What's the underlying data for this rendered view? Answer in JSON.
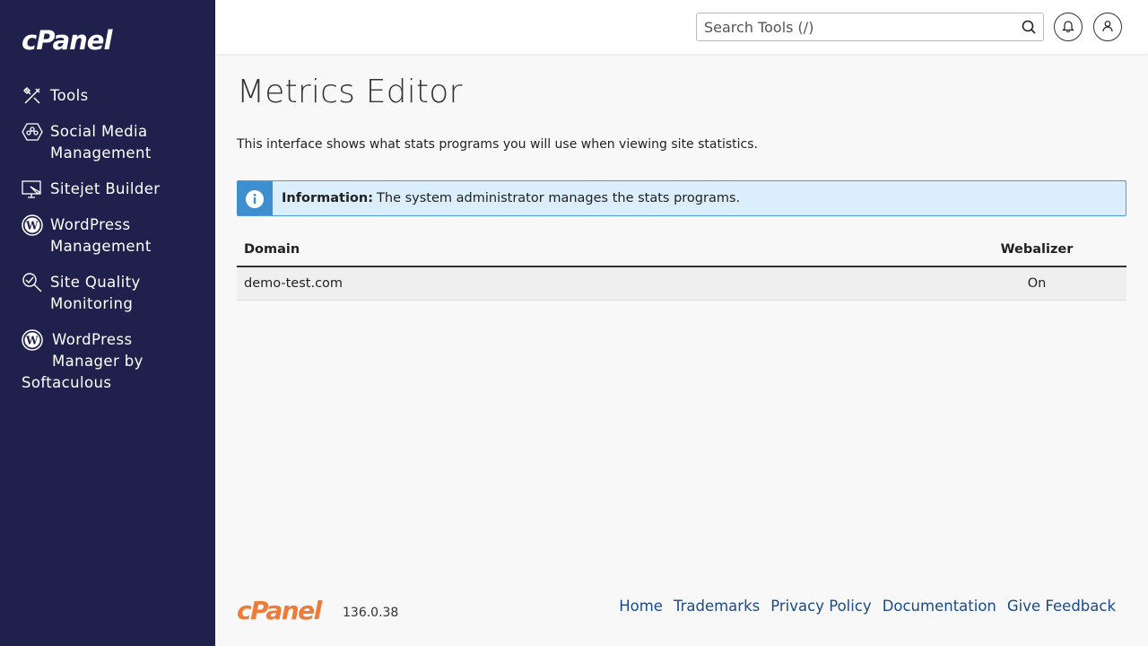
{
  "brand": {
    "logo_text": "cPanel",
    "footer_logo_text": "cPanel",
    "version": "136.0.38"
  },
  "sidebar": {
    "items": [
      {
        "label": "Tools",
        "icon": "tools-icon"
      },
      {
        "label": "Social Media\nManagement",
        "icon": "social-media-icon"
      },
      {
        "label": "Sitejet Builder",
        "icon": "sitejet-icon"
      },
      {
        "label": "WordPress\nManagement",
        "icon": "wordpress-icon"
      },
      {
        "label": "Site Quality\nMonitoring",
        "icon": "site-quality-icon"
      },
      {
        "label": "WordPress\nManager by",
        "label2": "Softaculous",
        "icon": "wordpress-icon"
      }
    ]
  },
  "header": {
    "search_placeholder": "Search Tools (/)"
  },
  "main": {
    "title": "Metrics Editor",
    "description": "This interface shows what stats programs you will use when viewing site statistics.",
    "alert": {
      "label": "Information:",
      "text": "The system administrator manages the stats programs."
    },
    "table": {
      "headers": [
        "Domain",
        "Webalizer"
      ],
      "rows": [
        [
          "demo-test.com",
          "On"
        ]
      ]
    }
  },
  "footer": {
    "links": [
      "Home",
      "Trademarks",
      "Privacy Policy",
      "Documentation",
      "Give Feedback"
    ]
  },
  "colors": {
    "sidebar_bg": "#1f214c",
    "accent_orange": "#ef7b38",
    "info_blue": "#3d8fd0",
    "link": "#1a4a8a"
  }
}
